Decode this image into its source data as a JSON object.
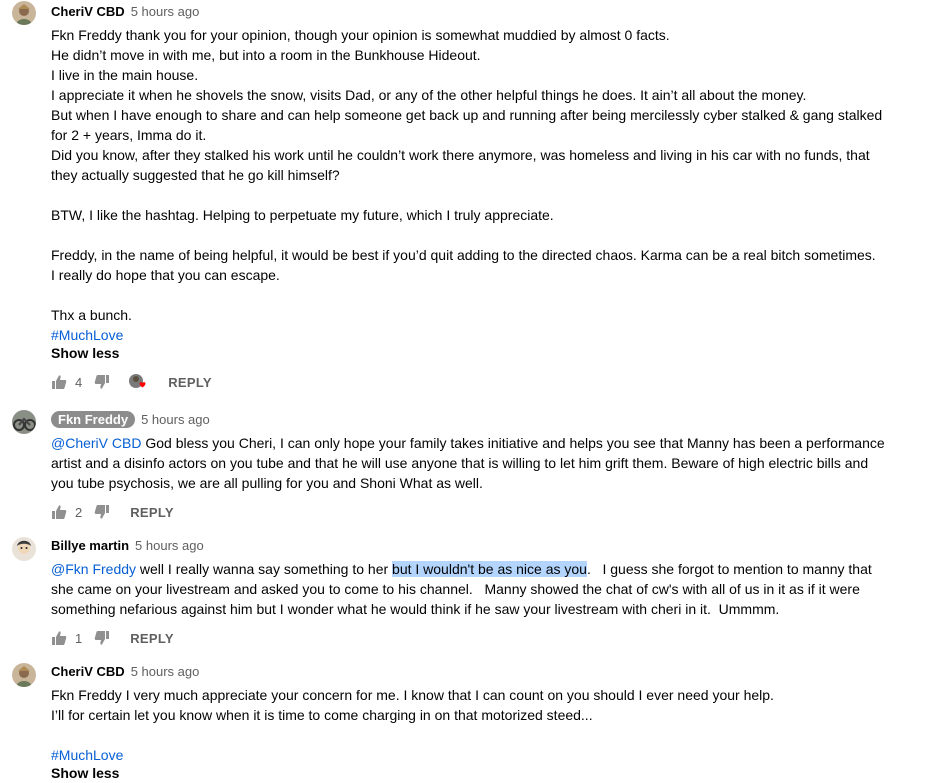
{
  "comments": [
    {
      "author": "CheriV CBD",
      "time": "5 hours ago",
      "lines": [
        "Fkn Freddy thank you for your opinion, though your opinion is somewhat muddied by almost 0 facts.",
        "He didn’t move in with me, but into a room in the Bunkhouse Hideout.",
        "I live in the main house.",
        "I appreciate it when he shovels the snow, visits Dad, or any of the other helpful things he does. It ain’t all about the money.",
        "But when I have enough to share and can help someone get back up and running after being mercilessly cyber stalked & gang stalked",
        "for 2 + years, Imma do it.",
        "Did you know, after they stalked his work until he couldn’t work there anymore, was homeless and living in his car with no funds, that",
        "they actually suggested that he go kill himself?",
        "BTW, I like the hashtag. Helping to perpetuate my future, which I truly appreciate.",
        "Freddy, in the name of being helpful, it would be best if you’d quit adding to the directed chaos. Karma can be a real bitch sometimes.",
        "I really do hope that you can escape.",
        "Thx a bunch."
      ],
      "hashtag": "#MuchLove",
      "show_less": "Show less",
      "likes": "4",
      "reply": "REPLY"
    },
    {
      "author": "Fkn Freddy",
      "time": "5 hours ago",
      "mention": "@CheriV CBD",
      "lines": [
        " God bless you Cheri, I can only hope your family takes initiative and helps you see that Manny has been a performance",
        "artist and a disinfo actors on you tube and that he will use anyone that is willing to let him grift them. Beware of high electric bills and",
        "you tube psychosis, we are all pulling for you and Shoni What as well."
      ],
      "likes": "2",
      "reply": "REPLY"
    },
    {
      "author": "Billye martin",
      "time": "5 hours ago",
      "mention": "@Fkn Freddy",
      "line1_pre": " well I really wanna say something to her ",
      "line1_highlight": "but I wouldn't be as nice as you",
      "line1_post": ".   I guess she forgot to mention to manny that",
      "lines": [
        "she came on your livestream and asked you to come to his channel.   Manny showed the chat of cw's with all of us in it as if it were",
        "something nefarious against him but I wonder what he would think if he saw your livestream with cheri in it.  Ummmm."
      ],
      "likes": "1",
      "reply": "REPLY"
    },
    {
      "author": "CheriV CBD",
      "time": "5 hours ago",
      "lines": [
        "Fkn Freddy I very much appreciate your concern for me. I know that I can count on you should I ever need your help.",
        "I’ll for certain let you know when it is time to come charging in on that motorized steed..."
      ],
      "hashtag": "#MuchLove",
      "show_less": "Show less"
    }
  ],
  "colors": {
    "link": "#065fd4",
    "highlight": "#b3d4fc",
    "heart": "#ff0000",
    "secondary": "#606060"
  },
  "icons": [
    "thumb-up-icon",
    "thumb-down-icon",
    "creator-heart-icon"
  ]
}
